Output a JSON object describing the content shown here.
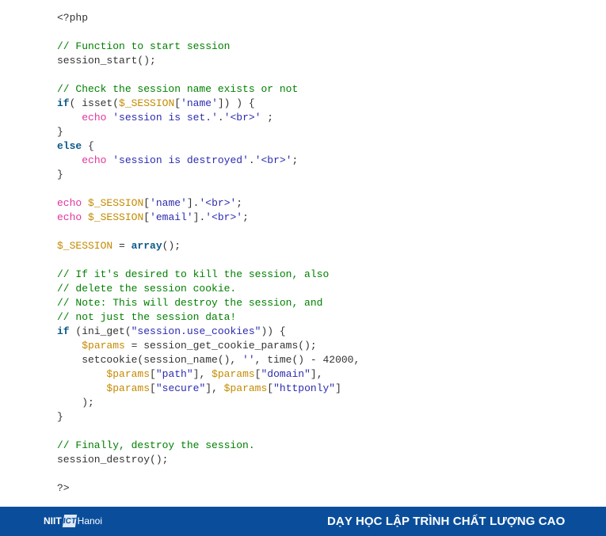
{
  "code": {
    "lines": [
      [
        [
          "p",
          "<?php"
        ]
      ],
      [],
      [
        [
          "c",
          "// Function to start session"
        ]
      ],
      [
        [
          "p",
          "session_start();"
        ]
      ],
      [],
      [
        [
          "c",
          "// Check the session name exists or not"
        ]
      ],
      [
        [
          "k",
          "if"
        ],
        [
          "p",
          "( isset("
        ],
        [
          "v",
          "$_SESSION"
        ],
        [
          "p",
          "["
        ],
        [
          "s",
          "'name'"
        ],
        [
          "p",
          "]) ) {"
        ]
      ],
      [
        [
          "p",
          "    "
        ],
        [
          "e",
          "echo"
        ],
        [
          "p",
          " "
        ],
        [
          "s",
          "'session is set.'"
        ],
        [
          "p",
          "."
        ],
        [
          "s",
          "'<br>'"
        ],
        [
          "p",
          " ;"
        ]
      ],
      [
        [
          "p",
          "}"
        ]
      ],
      [
        [
          "k",
          "else"
        ],
        [
          "p",
          " {"
        ]
      ],
      [
        [
          "p",
          "    "
        ],
        [
          "e",
          "echo"
        ],
        [
          "p",
          " "
        ],
        [
          "s",
          "'session is destroyed'"
        ],
        [
          "p",
          "."
        ],
        [
          "s",
          "'<br>'"
        ],
        [
          "p",
          ";"
        ]
      ],
      [
        [
          "p",
          "}"
        ]
      ],
      [],
      [
        [
          "e",
          "echo"
        ],
        [
          "p",
          " "
        ],
        [
          "v",
          "$_SESSION"
        ],
        [
          "p",
          "["
        ],
        [
          "s",
          "'name'"
        ],
        [
          "p",
          "]."
        ],
        [
          "s",
          "'<br>'"
        ],
        [
          "p",
          ";"
        ]
      ],
      [
        [
          "e",
          "echo"
        ],
        [
          "p",
          " "
        ],
        [
          "v",
          "$_SESSION"
        ],
        [
          "p",
          "["
        ],
        [
          "s",
          "'email'"
        ],
        [
          "p",
          "]."
        ],
        [
          "s",
          "'<br>'"
        ],
        [
          "p",
          ";"
        ]
      ],
      [],
      [
        [
          "v",
          "$_SESSION"
        ],
        [
          "p",
          " = "
        ],
        [
          "k",
          "array"
        ],
        [
          "p",
          "();"
        ]
      ],
      [],
      [
        [
          "c",
          "// If it's desired to kill the session, also"
        ]
      ],
      [
        [
          "c",
          "// delete the session cookie."
        ]
      ],
      [
        [
          "c",
          "// Note: This will destroy the session, and"
        ]
      ],
      [
        [
          "c",
          "// not just the session data!"
        ]
      ],
      [
        [
          "k",
          "if"
        ],
        [
          "p",
          " (ini_get("
        ],
        [
          "s",
          "\"session.use_cookies\""
        ],
        [
          "p",
          ")) {"
        ]
      ],
      [
        [
          "p",
          "    "
        ],
        [
          "v",
          "$params"
        ],
        [
          "p",
          " = session_get_cookie_params();"
        ]
      ],
      [
        [
          "p",
          "    setcookie(session_name(), "
        ],
        [
          "s",
          "''"
        ],
        [
          "p",
          ", time() - 42000,"
        ]
      ],
      [
        [
          "p",
          "        "
        ],
        [
          "v",
          "$params"
        ],
        [
          "p",
          "["
        ],
        [
          "s",
          "\"path\""
        ],
        [
          "p",
          "], "
        ],
        [
          "v",
          "$params"
        ],
        [
          "p",
          "["
        ],
        [
          "s",
          "\"domain\""
        ],
        [
          "p",
          "],"
        ]
      ],
      [
        [
          "p",
          "        "
        ],
        [
          "v",
          "$params"
        ],
        [
          "p",
          "["
        ],
        [
          "s",
          "\"secure\""
        ],
        [
          "p",
          "], "
        ],
        [
          "v",
          "$params"
        ],
        [
          "p",
          "["
        ],
        [
          "s",
          "\"httponly\""
        ],
        [
          "p",
          "]"
        ]
      ],
      [
        [
          "p",
          "    );"
        ]
      ],
      [
        [
          "p",
          "}"
        ]
      ],
      [],
      [
        [
          "c",
          "// Finally, destroy the session."
        ]
      ],
      [
        [
          "p",
          "session_destroy();"
        ]
      ],
      [],
      [
        [
          "p",
          "?>"
        ]
      ]
    ]
  },
  "footer": {
    "logo": {
      "brand": "NIIT",
      "mark": "ICT",
      "city": "Hanoi"
    },
    "tagline": "DẠY HỌC LẬP TRÌNH CHẤT LƯỢNG CAO",
    "background": "#0a4e9b"
  },
  "colors": {
    "comment": "#008000",
    "keyword": "#0b5a8a",
    "echo": "#e0359c",
    "variable": "#c48a00",
    "string": "#2b2bb0"
  }
}
